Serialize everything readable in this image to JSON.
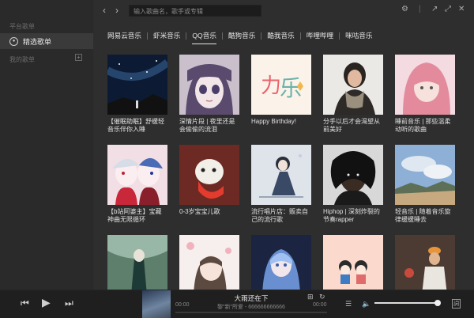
{
  "sidebar": {
    "section_platform": "平台歌单",
    "featured_item": "精选歌单",
    "section_my": "我的歌单",
    "add_symbol": "+"
  },
  "topbar": {
    "back_icon": "‹",
    "forward_icon": "›",
    "search_placeholder": "输入歌曲名，歌手或专辑",
    "settings_icon": "⚙",
    "window_icons": [
      "↗",
      "⤢",
      "⛶",
      "✕"
    ]
  },
  "tabs": [
    {
      "label": "网易云音乐",
      "active": false
    },
    {
      "label": "虾米音乐",
      "active": false
    },
    {
      "label": "QQ音乐",
      "active": true
    },
    {
      "label": "酷狗音乐",
      "active": false
    },
    {
      "label": "酷我音乐",
      "active": false
    },
    {
      "label": "哔哩哔哩",
      "active": false
    },
    {
      "label": "咪咕音乐",
      "active": false
    }
  ],
  "playlists": [
    {
      "title": "【催眠助眠】舒缓轻音乐伴你入睡",
      "cover_icon": "starry-night-cover"
    },
    {
      "title": "深情片段 | 夜里还是会偷偷的流泪",
      "cover_icon": "anime-girl-crying-cover"
    },
    {
      "title": "Happy Birthday!",
      "cover_icon": "birthday-art-text-cover"
    },
    {
      "title": "分手以后才会渴望从前美好",
      "cover_icon": "woman-scarf-cover"
    },
    {
      "title": "睡前音乐 | 那些温柔动听的歌曲",
      "cover_icon": "pink-hood-girl-cover"
    },
    {
      "title": "【b站阿婆主】宝藏神曲无限循环",
      "cover_icon": "anime-duo-cover"
    },
    {
      "title": "0-3岁宝宝儿歌",
      "cover_icon": "cartoon-bear-cover"
    },
    {
      "title": "流行唱片店：贩卖自己的流行歌",
      "cover_icon": "anime-boy-night-cover"
    },
    {
      "title": "Hiphop | 深刻炸裂的节奏rapper",
      "cover_icon": "rapper-portrait-cover"
    },
    {
      "title": "轻音乐 | 随着音乐旋律缓缓睡去",
      "cover_icon": "blue-sky-cover"
    },
    {
      "title": "",
      "cover_icon": "green-forest-cover"
    },
    {
      "title": "",
      "cover_icon": "sketch-girl-cover"
    },
    {
      "title": "",
      "cover_icon": "vocaloid-cover"
    },
    {
      "title": "",
      "cover_icon": "cartoon-couple-cover"
    },
    {
      "title": "",
      "cover_icon": "street-photo-cover"
    }
  ],
  "player": {
    "prev_icon": "⏮",
    "play_icon": "▶",
    "next_icon": "⏭",
    "song_title": "大雨还在下",
    "song_artist": "黎\"新\"所爱 - 666666666666",
    "time_current": "00:00",
    "time_total": "00:00",
    "progress": 0.0,
    "volume": 1.0,
    "add_icon": "⊞",
    "loop_icon": "↻",
    "queue_icon": "☰",
    "volume_icon": "🔈",
    "lyrics_icon": "詞"
  }
}
